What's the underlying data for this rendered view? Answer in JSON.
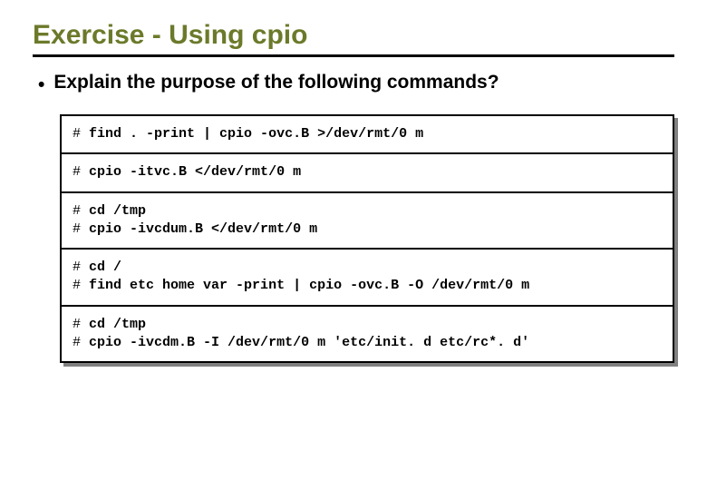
{
  "title": "Exercise - Using cpio",
  "bullet": "Explain the purpose of the following commands?",
  "prompt": "#",
  "commands": {
    "r0": {
      "l0": "find . -print | cpio -ovc.B >/dev/rmt/0 m"
    },
    "r1": {
      "l0": "cpio -itvc.B </dev/rmt/0 m"
    },
    "r2": {
      "l0": "cd /tmp",
      "l1": "cpio -ivcdum.B </dev/rmt/0 m"
    },
    "r3": {
      "l0": "cd /",
      "l1": "find etc home var -print | cpio -ovc.B -O /dev/rmt/0 m"
    },
    "r4": {
      "l0": "cd /tmp",
      "l1": "cpio -ivcdm.B -I /dev/rmt/0 m 'etc/init. d etc/rc*. d'"
    }
  }
}
